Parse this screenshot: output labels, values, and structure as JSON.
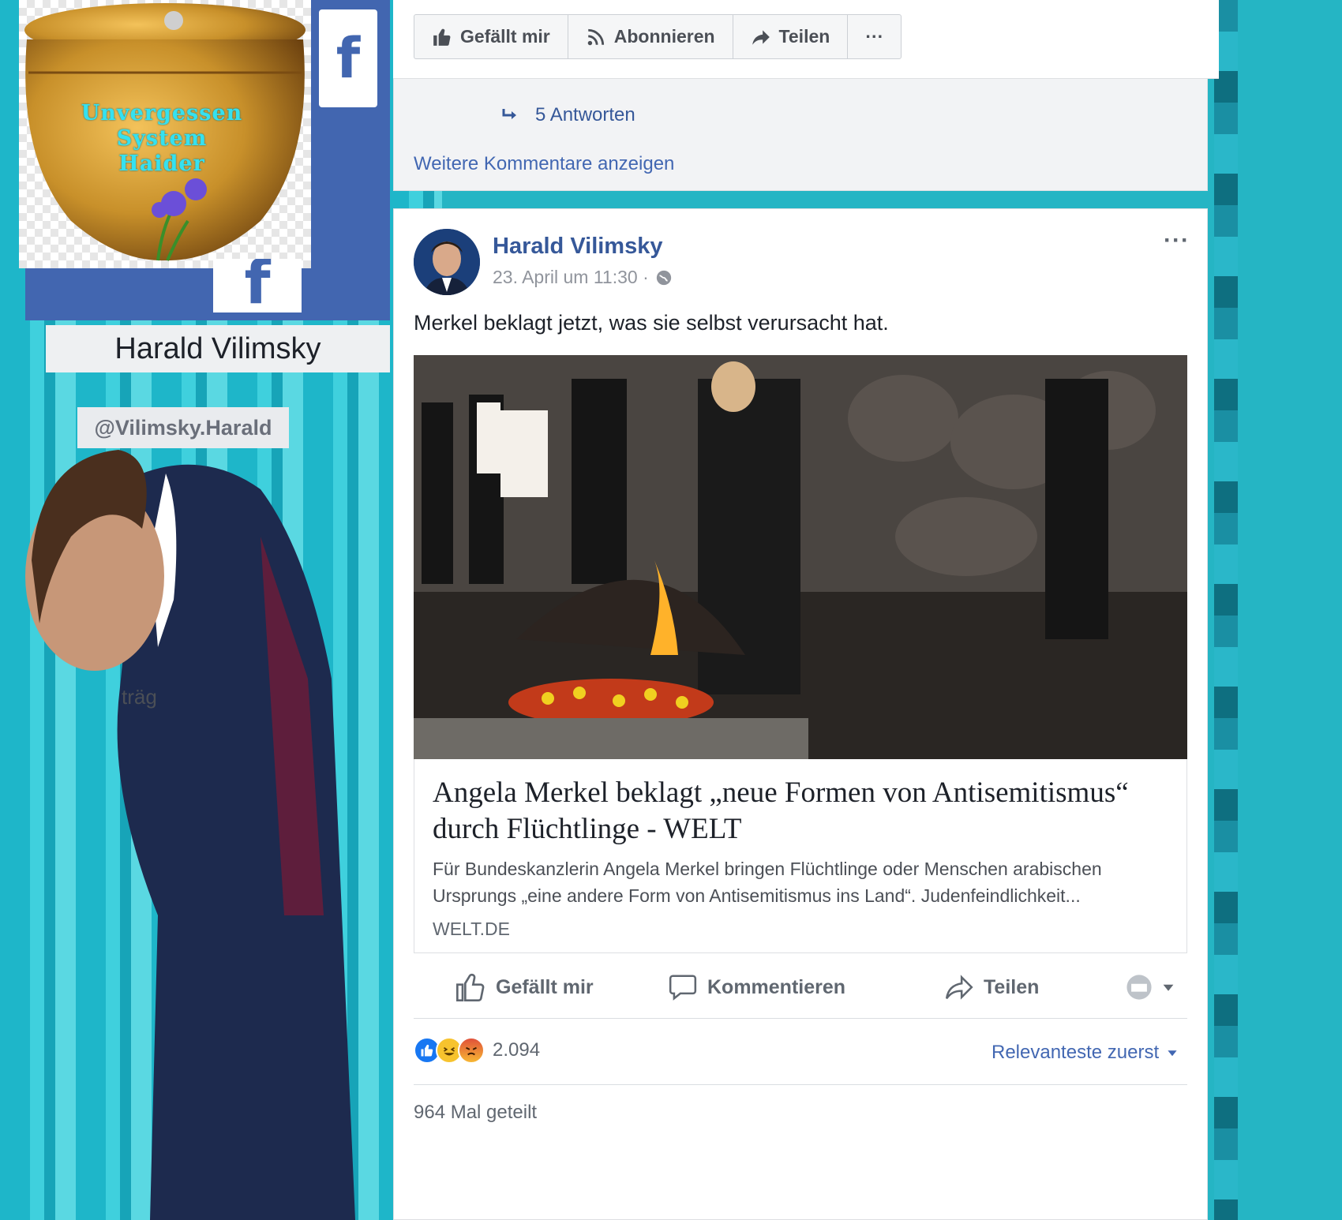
{
  "collage": {
    "urn_text_line1": "Unvergessen",
    "urn_text_line2": "System",
    "urn_text_line3": "Haider",
    "name": "Harald Vilimsky",
    "handle": "@Vilimsky.Harald",
    "fragment": "träg",
    "fb_glyph": "f"
  },
  "top_actions": {
    "like": "Gefällt mir",
    "subscribe": "Abonnieren",
    "share": "Teilen",
    "more": "···"
  },
  "comments": {
    "replies": "5 Antworten",
    "more_comments": "Weitere Kommentare anzeigen"
  },
  "post": {
    "author": "Harald Vilimsky",
    "timestamp": "23. April um 11:30 ·",
    "menu": "···",
    "text": "Merkel beklagt jetzt, was sie selbst verursacht hat.",
    "link": {
      "title": "Angela Merkel beklagt „neue Formen von Antisemitismus“ durch Flüchtlinge - WELT",
      "description": "Für Bundeskanzlerin Angela Merkel bringen Flüchtlinge oder Menschen arabischen Ursprungs „eine andere Form von Antisemitismus ins Land“. Judenfeindlichkeit...",
      "domain": "WELT.DE"
    },
    "actions": {
      "like": "Gefällt mir",
      "comment": "Kommentieren",
      "share": "Teilen"
    },
    "reaction_count": "2.094",
    "sort": "Relevanteste zuerst",
    "shares": "964 Mal geteilt"
  },
  "colors": {
    "fb_blue": "#4266b0",
    "link_blue": "#365899",
    "urn_gold": "#c8902a",
    "collage_teal": "#25b5c4"
  }
}
